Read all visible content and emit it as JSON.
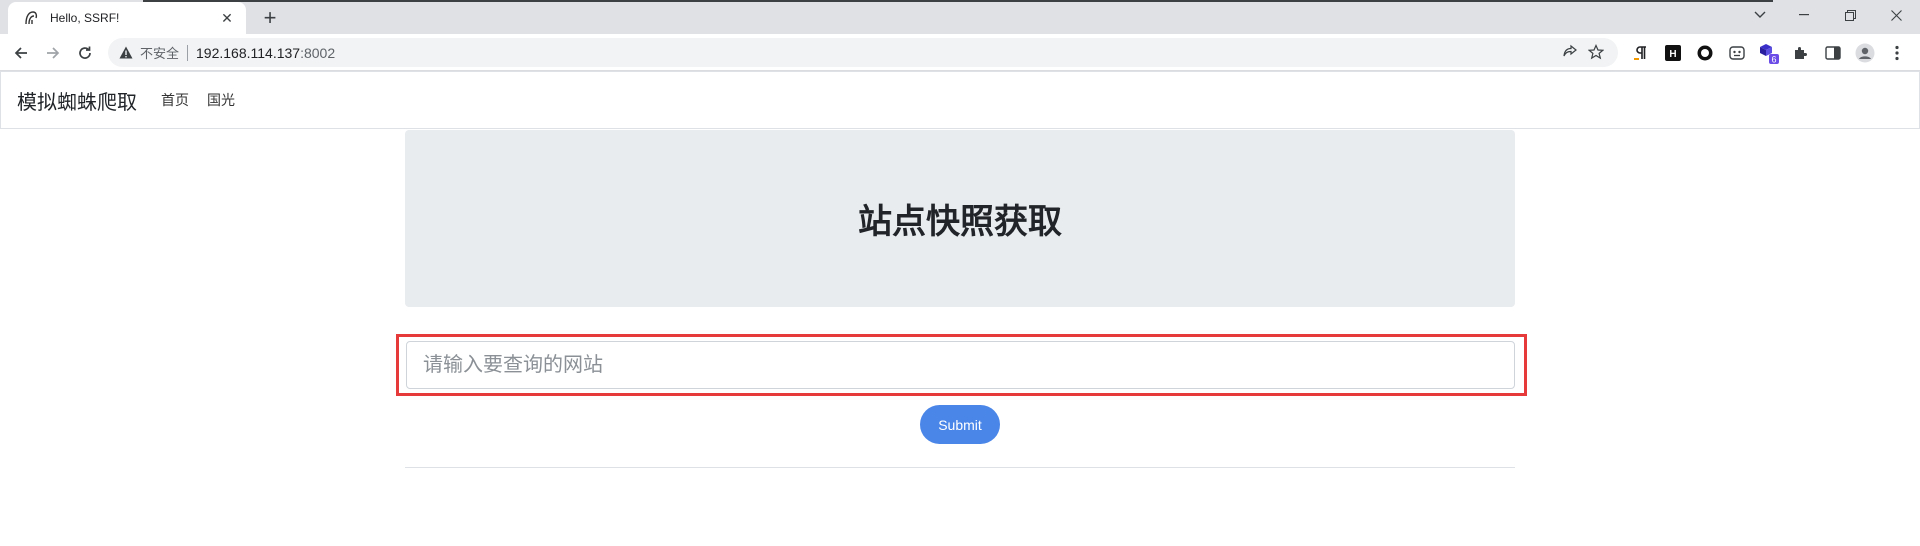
{
  "browser": {
    "tab_title": "Hello, SSRF!",
    "security_label": "不安全",
    "url_host": "192.168.114.137",
    "url_port": ":8002",
    "extension_badge": "6"
  },
  "navbar": {
    "brand": "模拟蜘蛛爬取",
    "links": [
      "首页",
      "国光"
    ]
  },
  "hero": {
    "title": "站点快照获取"
  },
  "form": {
    "placeholder": "请输入要查询的网站",
    "value": "",
    "submit_label": "Submit"
  },
  "colors": {
    "highlight": "#e63a3a",
    "submit_bg": "#4a86e8",
    "hero_bg": "#e9ecef"
  }
}
